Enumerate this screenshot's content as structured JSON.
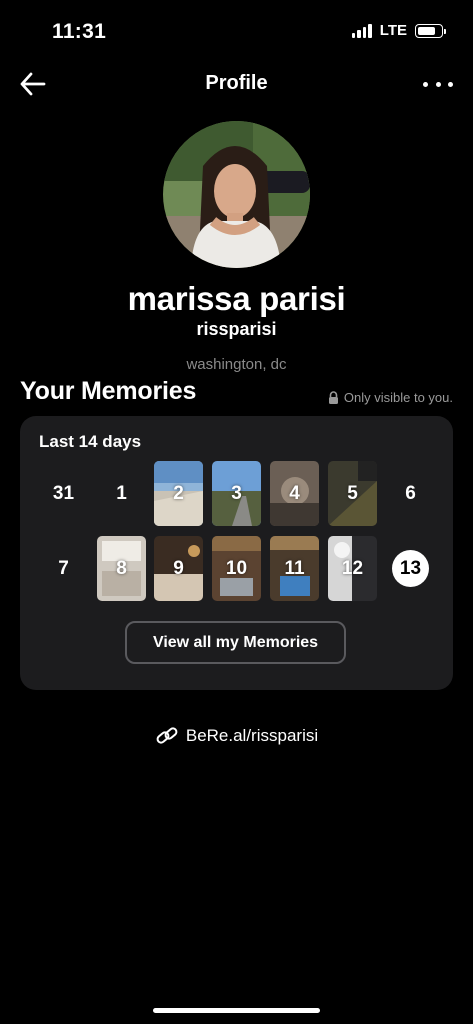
{
  "status_bar": {
    "time": "11:31",
    "network": "LTE",
    "battery_level": 0.85
  },
  "header": {
    "title": "Profile",
    "back_icon": "arrow-left-icon",
    "more_icon": "ellipsis-icon"
  },
  "profile": {
    "display_name": "marissa parisi",
    "username": "rissparisi",
    "location": "washington, dc"
  },
  "memories": {
    "title": "Your Memories",
    "visibility_note": "Only visible to you.",
    "period_label": "Last 14 days",
    "days": [
      {
        "label": "31",
        "has_photo": false
      },
      {
        "label": "1",
        "has_photo": false
      },
      {
        "label": "2",
        "has_photo": true
      },
      {
        "label": "3",
        "has_photo": true
      },
      {
        "label": "4",
        "has_photo": true
      },
      {
        "label": "5",
        "has_photo": true
      },
      {
        "label": "6",
        "has_photo": false
      },
      {
        "label": "7",
        "has_photo": false
      },
      {
        "label": "8",
        "has_photo": true
      },
      {
        "label": "9",
        "has_photo": true
      },
      {
        "label": "10",
        "has_photo": true
      },
      {
        "label": "11",
        "has_photo": true
      },
      {
        "label": "12",
        "has_photo": true
      },
      {
        "label": "13",
        "has_photo": false,
        "today": true
      }
    ],
    "view_all_label": "View all my Memories"
  },
  "profile_link": {
    "icon": "link-icon",
    "text": "BeRe.al/rissparisi"
  }
}
